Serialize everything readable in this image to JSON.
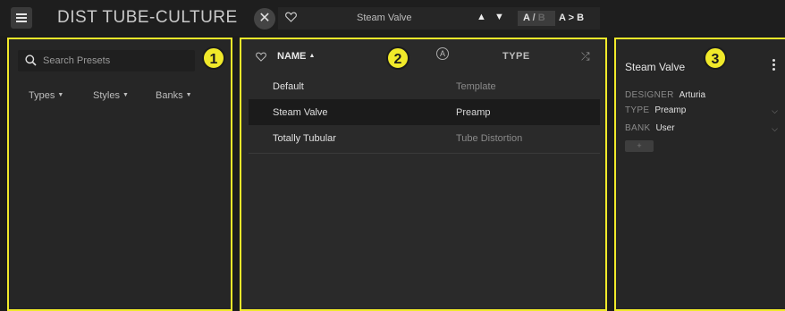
{
  "header": {
    "app_title": "DIST TUBE-CULTURE",
    "preset_name": "Steam Valve",
    "ab_a": "A",
    "ab_slash": "/",
    "ab_b": "B",
    "a_to_b": "A > B"
  },
  "markers": {
    "one": "1",
    "two": "2",
    "three": "3"
  },
  "browser": {
    "search_placeholder": "Search Presets",
    "filters": [
      "Types",
      "Styles",
      "Banks"
    ]
  },
  "list": {
    "name_header": "NAME",
    "type_header": "TYPE",
    "rows": [
      {
        "name": "Default",
        "type": "Template"
      },
      {
        "name": "Steam Valve",
        "type": "Preamp"
      },
      {
        "name": "Totally Tubular",
        "type": "Tube Distortion"
      }
    ]
  },
  "detail": {
    "title": "Steam Valve",
    "designer_label": "DESIGNER",
    "designer_value": "Arturia",
    "type_label": "TYPE",
    "type_value": "Preamp",
    "bank_label": "BANK",
    "bank_value": "User",
    "add_label": "+"
  },
  "colors": {
    "highlight": "#f0e92a",
    "background": "#1c1c1c",
    "panel": "#262626"
  }
}
